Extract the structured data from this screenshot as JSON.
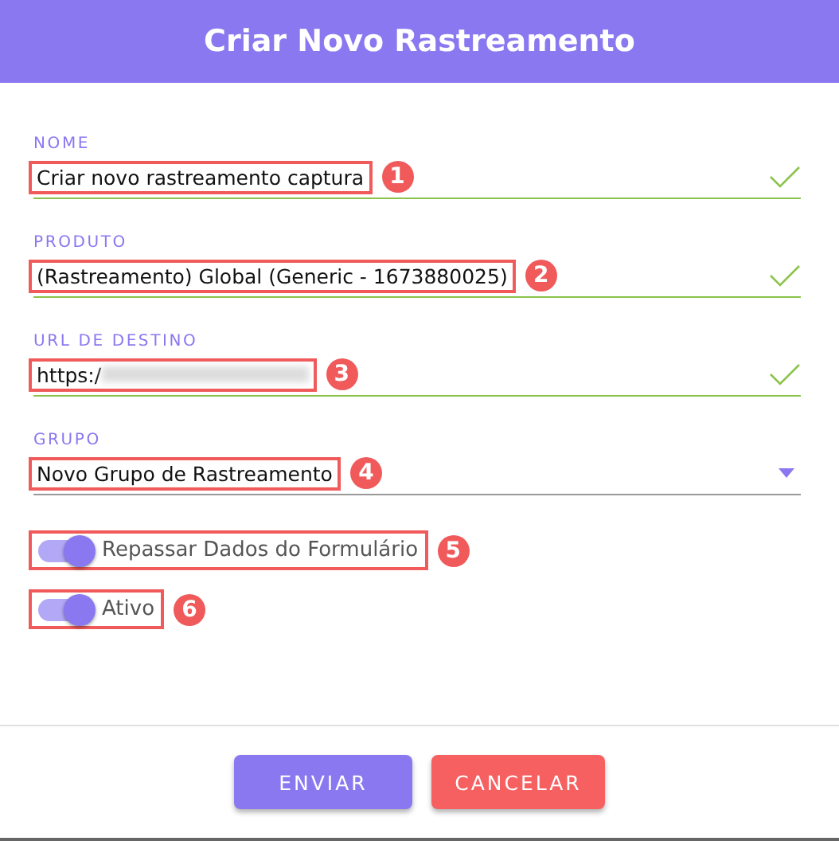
{
  "dialog": {
    "title": "Criar Novo Rastreamento"
  },
  "fields": [
    {
      "kind": "text",
      "label": "NOME",
      "value": "Criar novo rastreamento captura",
      "valid": true,
      "marker": "1"
    },
    {
      "kind": "text",
      "label": "PRODUTO",
      "value": "(Rastreamento) Global (Generic - 1673880025)",
      "valid": true,
      "marker": "2"
    },
    {
      "kind": "redacted",
      "label": "URL DE DESTINO",
      "value": "https:/",
      "valid": true,
      "marker": "3"
    },
    {
      "kind": "select",
      "label": "GRUPO",
      "value": "Novo Grupo de Rastreamento",
      "valid": false,
      "marker": "4"
    }
  ],
  "switches": [
    {
      "label": "Repassar Dados do Formulário",
      "on": true,
      "marker": "5"
    },
    {
      "label": "Ativo",
      "on": true,
      "marker": "6"
    }
  ],
  "buttons": [
    {
      "kind": "primary",
      "label": "ENVIAR"
    },
    {
      "kind": "danger",
      "label": "CANCELAR"
    }
  ]
}
